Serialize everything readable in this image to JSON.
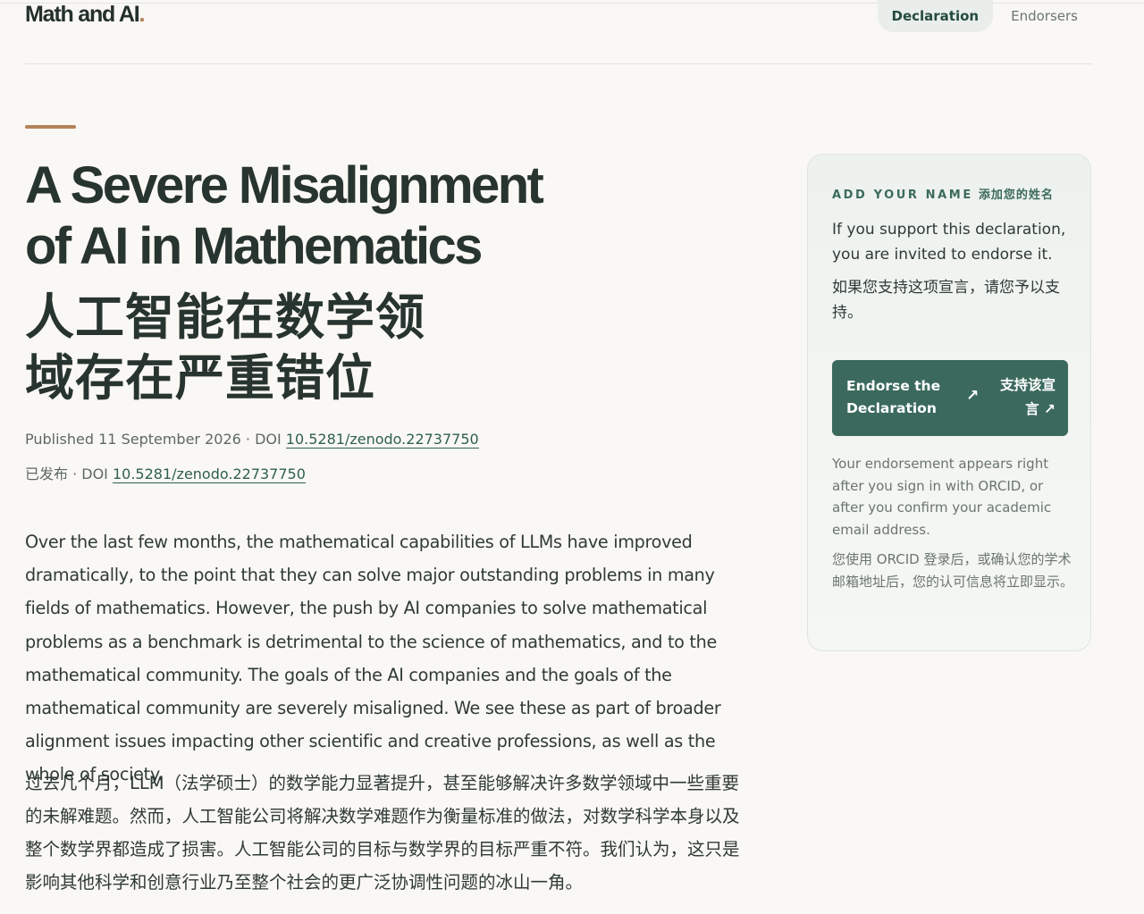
{
  "brand": {
    "name": "Math and AI",
    "dot": "."
  },
  "nav": {
    "items": [
      {
        "label": "Declaration",
        "active": true
      },
      {
        "label": "Endorsers",
        "active": false
      }
    ]
  },
  "article": {
    "title_en": "A Severe Misalignment of AI in Mathematics",
    "title_zh": "人工智能在数学领域存在严重错位",
    "meta_en_prefix": "Published 11 September 2026 · DOI ",
    "meta_zh_prefix": "已发布 · DOI ",
    "doi": "10.5281/zenodo.22737750",
    "body_en": "Over the last few months, the mathematical capabilities of LLMs have improved dramatically, to the point that they can solve major outstanding problems in many fields of mathematics. However, the push by AI companies to solve mathematical problems as a benchmark is detrimental to the science of mathematics, and to the mathematical community. The goals of the AI companies and the goals of the mathematical community are severely misaligned. We see these as part of broader alignment issues impacting other scientific and creative professions, as well as the whole of society.",
    "body_zh": "过去几个月，LLM（法学硕士）的数学能力显著提升，甚至能够解决许多数学领域中一些重要的未解难题。然而，人工智能公司将解决数学难题作为衡量标准的做法，对数学科学本身以及整个数学界都造成了损害。人工智能公司的目标与数学界的目标严重不符。我们认为，这只是影响其他科学和创意行业乃至整个社会的更广泛协调性问题的冰山一角。"
  },
  "endorse_card": {
    "kicker_en": "ADD YOUR NAME",
    "kicker_zh": "添加您的姓名",
    "intro_en": "If you support this declaration, you are invited to endorse it.",
    "intro_zh": "如果您支持这项宣言，请您予以支持。",
    "button_en": "Endorse the Declaration",
    "button_zh": "支持该宣言",
    "button_arrow": "↗",
    "note_en": "Your endorsement appears right after you sign in with ORCID, or after you confirm your academic email address.",
    "note_zh": "您使用 ORCID 登录后，或确认您的学术邮箱地址后，您的认可信息将立即显示。"
  },
  "colors": {
    "background": "#faf8f4",
    "accent": "#b4825a",
    "brand_green": "#3b6a5d",
    "text": "#2c3a36"
  }
}
